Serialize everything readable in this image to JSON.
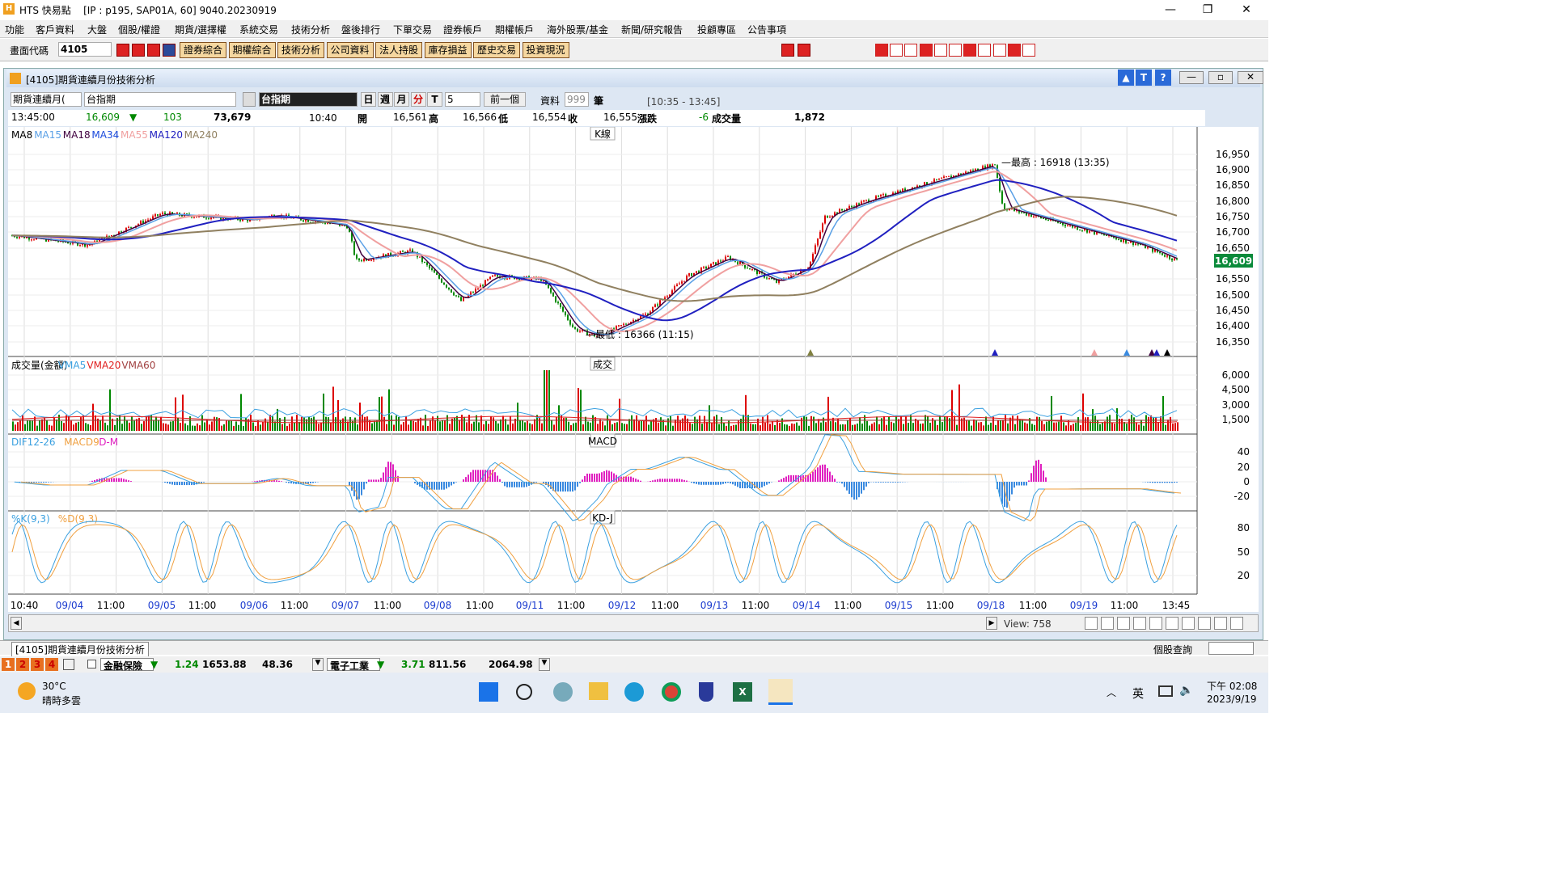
{
  "window": {
    "title": "HTS 快易點",
    "conn": "[IP : p195, SAP01A, 60] 9040.20230919"
  },
  "menu": [
    "功能",
    "客戶資料",
    "大盤",
    "個股/權證",
    "期貨/選擇權",
    "系統交易",
    "技術分析",
    "盤後排行",
    "下單交易",
    "證券帳戶",
    "期權帳戶",
    "海外股票/基金",
    "新聞/研究報告",
    "投顧專區",
    "公告事項"
  ],
  "toolbar": {
    "code_label": "畫面代碼",
    "code_value": "4105",
    "buttons": [
      "證券綜合",
      "期權綜合",
      "技術分析",
      "公司資料",
      "法人持股",
      "庫存損益",
      "歷史交易",
      "投資現況"
    ]
  },
  "subwin": {
    "title": "[4105]期貨連續月份技術分析"
  },
  "controls": {
    "type": "期貨連續月(",
    "symbol": "台指期",
    "name": "台指期",
    "periods": [
      "日",
      "週",
      "月",
      "分",
      "T"
    ],
    "minutes": "5",
    "prev": "前一個",
    "data_label": "資料",
    "data_count": "999",
    "unit": "筆",
    "range": "[10:35 - 13:45]"
  },
  "quote": {
    "time": "13:45:00",
    "price": "16,609",
    "change": "103",
    "vol": "73,679",
    "qtime": "10:40",
    "open_l": "開",
    "open": "16,561",
    "high_l": "高",
    "high": "16,566",
    "low_l": "低",
    "low": "16,554",
    "close_l": "收",
    "close": "16,555",
    "diff_l": "漲跌",
    "diff": "-6",
    "volume_l": "成交量",
    "volume": "1,872"
  },
  "k": {
    "legend": [
      "MA8",
      "MA15",
      "MA18",
      "MA34",
      "MA55",
      "MA120",
      "MA240"
    ],
    "colors": [
      "#000",
      "#5aa0e6",
      "#400040",
      "#1a4adc",
      "#f0a0a0",
      "#2020c0",
      "#908060"
    ],
    "tag": "K線",
    "hi": "最高 : 16918 (13:35)",
    "lo": "最低 : 16366 (11:15)",
    "last": "16,609",
    "yticks": [
      "16,950",
      "16,900",
      "16,850",
      "16,800",
      "16,750",
      "16,700",
      "16,650",
      "16,550",
      "16,500",
      "16,450",
      "16,400",
      "16,350"
    ]
  },
  "vol": {
    "legend": [
      "成交量(金額)",
      "VMA5",
      "VMA20",
      "VMA60"
    ],
    "tag": "成交",
    "yticks": [
      "6,000",
      "4,500",
      "3,000",
      "1,500"
    ]
  },
  "macd": {
    "legend": [
      "DIF12-26",
      "MACD9",
      "D-M"
    ],
    "tag": "MACD",
    "yticks": [
      "40",
      "20",
      "0",
      "-20"
    ]
  },
  "kd": {
    "legend": [
      "%K(9,3)",
      "%D(9,3)"
    ],
    "tag": "KD-J",
    "yticks": [
      "80",
      "50",
      "20"
    ]
  },
  "xaxis": [
    "10:40",
    "09/04",
    "11:00",
    "09/05",
    "11:00",
    "09/06",
    "11:00",
    "09/07",
    "11:00",
    "09/08",
    "11:00",
    "09/11",
    "11:00",
    "09/12",
    "11:00",
    "09/13",
    "11:00",
    "09/14",
    "11:00",
    "09/15",
    "11:00",
    "09/18",
    "11:00",
    "09/19",
    "11:00",
    "13:45"
  ],
  "view": "View: 758",
  "tab": "[4105]期貨連續月份技術分析",
  "right_status": "個股查詢",
  "ticker": [
    {
      "name": "金融保險",
      "chg": "1.24",
      "idx": "1653.88",
      "vol": "48.36"
    },
    {
      "name": "電子工業",
      "chg": "3.71",
      "idx": "811.56",
      "vol": "2064.98"
    }
  ],
  "weather": {
    "temp": "30°C",
    "desc": "晴時多雲"
  },
  "clock": {
    "time": "下午 02:08",
    "date": "2023/9/19"
  },
  "ime": "英"
}
